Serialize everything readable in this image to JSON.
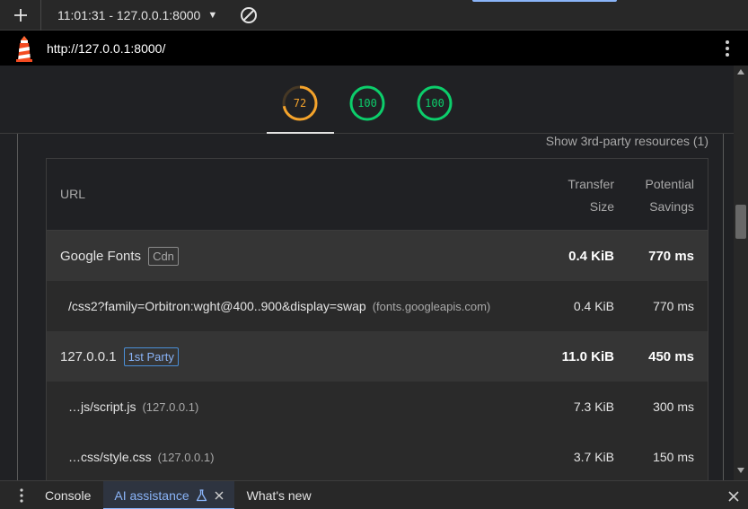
{
  "toolbar": {
    "report_label": "11:01:31 - 127.0.0.1:8000",
    "caret": "▼"
  },
  "urlbar": {
    "url": "http://127.0.0.1:8000/"
  },
  "scores": [
    {
      "value": "72",
      "fraction": 0.72,
      "color": "#f4a32b"
    },
    {
      "value": "100",
      "fraction": 1.0,
      "color": "#0cce6b"
    },
    {
      "value": "100",
      "fraction": 1.0,
      "color": "#0cce6b"
    }
  ],
  "report": {
    "show_3p": "Show 3rd-party resources (1)",
    "headers": {
      "url": "URL",
      "transfer_line1": "Transfer",
      "transfer_line2": "Size",
      "savings_line1": "Potential",
      "savings_line2": "Savings"
    },
    "rows": [
      {
        "kind": "group",
        "name": "Google Fonts",
        "badge": "Cdn",
        "size": "0.4 KiB",
        "time": "770 ms"
      },
      {
        "kind": "sub",
        "name": "/css2?family=Orbitron:wght@400..900&display=swap",
        "host": "(fonts.googleapis.com)",
        "size": "0.4 KiB",
        "time": "770 ms"
      },
      {
        "kind": "group",
        "name": "127.0.0.1",
        "badge": "1st Party",
        "size": "11.0 KiB",
        "time": "450 ms"
      },
      {
        "kind": "sub",
        "name": "…js/script.js",
        "host": "(127.0.0.1)",
        "size": "7.3 KiB",
        "time": "300 ms"
      },
      {
        "kind": "sub",
        "name": "…css/style.css",
        "host": "(127.0.0.1)",
        "size": "3.7 KiB",
        "time": "150 ms"
      }
    ]
  },
  "drawer": {
    "console": "Console",
    "ai": "AI assistance",
    "whats_new": "What's new"
  },
  "colors": {
    "accent": "#8ab4f8",
    "average": "#f4a32b",
    "pass": "#0cce6b"
  }
}
